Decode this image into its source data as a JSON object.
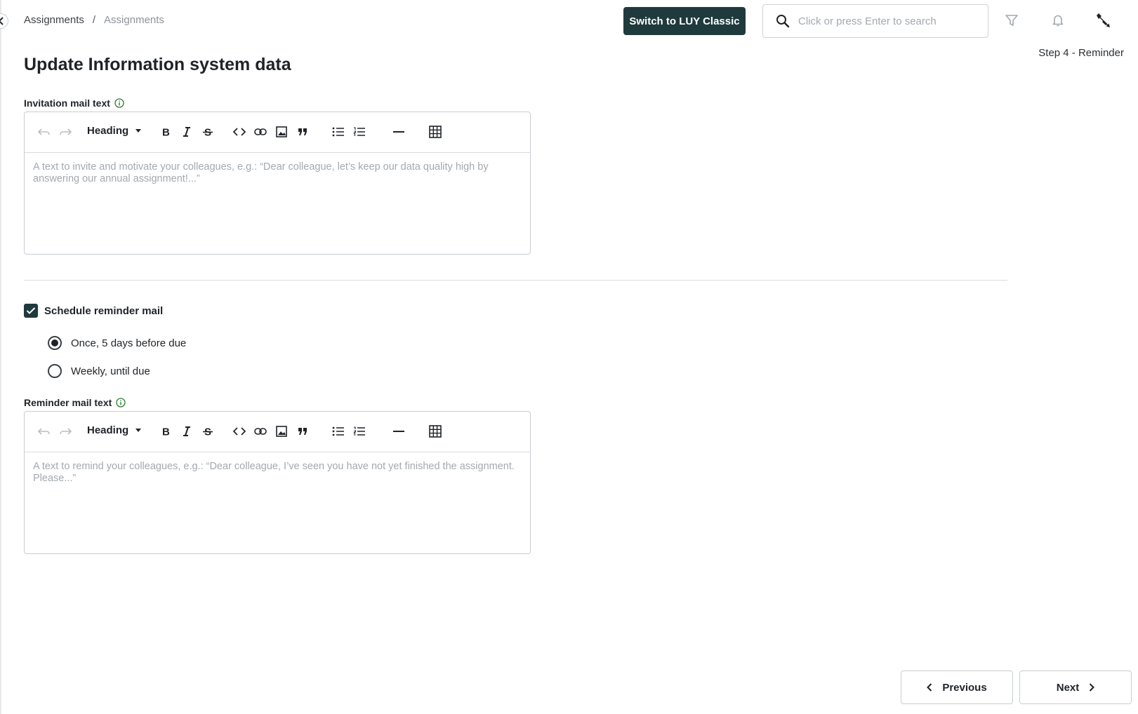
{
  "breadcrumb": {
    "items": [
      "Assignments",
      "Assignments"
    ],
    "separator": "/"
  },
  "header": {
    "switch_button": "Switch to LUY Classic",
    "search_placeholder": "Click or press Enter to search",
    "step": "Step 4 - Reminder"
  },
  "page": {
    "title": "Update Information system data"
  },
  "invitation": {
    "label": "Invitation mail text",
    "toolbar": {
      "heading": "Heading"
    },
    "placeholder": "A text to invite and motivate your colleagues, e.g.: “Dear colleague, let’s keep our data quality high by answering our annual assignment!...”"
  },
  "reminder_schedule": {
    "checkbox_label": "Schedule reminder mail",
    "checked": true,
    "options": [
      {
        "label": "Once, 5 days before due",
        "selected": true
      },
      {
        "label": "Weekly, until due",
        "selected": false
      }
    ]
  },
  "reminder": {
    "label": "Reminder mail text",
    "toolbar": {
      "heading": "Heading"
    },
    "placeholder": "A text to remind your colleagues, e.g.: “Dear colleague, I’ve seen you have not yet finished the assignment. Please...”"
  },
  "footer": {
    "previous": "Previous",
    "next": "Next"
  },
  "colors": {
    "primary": "#1f3a3d",
    "border": "#c9cdd1",
    "placeholder": "#a3a9af",
    "info_icon": "#2e7d32"
  },
  "icons": [
    "chevron-left-icon",
    "search-icon",
    "filter-icon",
    "bell-icon",
    "wrench-icon",
    "undo-icon",
    "redo-icon",
    "bold-icon",
    "italic-icon",
    "strikethrough-icon",
    "code-icon",
    "link-icon",
    "image-icon",
    "quote-icon",
    "bullet-list-icon",
    "numbered-list-icon",
    "horizontal-rule-icon",
    "table-icon",
    "check-icon",
    "info-icon",
    "chevron-right-icon"
  ]
}
